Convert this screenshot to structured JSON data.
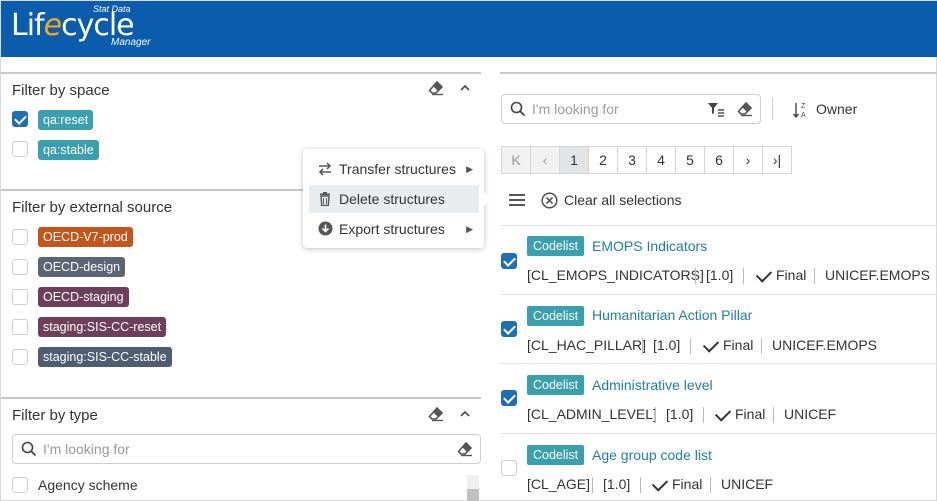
{
  "header": {
    "logo_small_top": "Stat Data",
    "logo_main_pre": "Lif",
    "logo_main_e": "e",
    "logo_main_post": "cycle",
    "logo_small_bottom": "Manager",
    "background_color": "#0b5cad"
  },
  "filter_space": {
    "title": "Filter by space",
    "items": [
      {
        "label": "qa:reset",
        "checked": true,
        "color": "#3aa0ad"
      },
      {
        "label": "qa:stable",
        "checked": false,
        "color": "#3aa0ad"
      }
    ]
  },
  "filter_external": {
    "title": "Filter by external source",
    "items": [
      {
        "label": "OECD-V7-prod",
        "checked": false,
        "color": "#c4561c"
      },
      {
        "label": "OECD-design",
        "checked": false,
        "color": "#5b6573"
      },
      {
        "label": "OECD-staging",
        "checked": false,
        "color": "#6e3f5a"
      },
      {
        "label": "staging:SIS-CC-reset",
        "checked": false,
        "color": "#6e3f5a"
      },
      {
        "label": "staging:SIS-CC-stable",
        "checked": false,
        "color": "#4f5d73"
      }
    ]
  },
  "filter_type": {
    "title": "Filter by type",
    "search_placeholder": "I'm looking for",
    "items": [
      {
        "label": "Agency scheme",
        "checked": false
      }
    ]
  },
  "context_menu": {
    "items": [
      {
        "label": "Transfer structures",
        "icon": "transfer-icon",
        "has_submenu": true
      },
      {
        "label": "Delete structures",
        "icon": "trash-icon",
        "has_submenu": false,
        "active": true
      },
      {
        "label": "Export structures",
        "icon": "download-circle-icon",
        "has_submenu": true
      }
    ]
  },
  "search": {
    "placeholder": "I'm looking for",
    "sort_label": "Owner"
  },
  "pagination": {
    "first": "K",
    "prev": "‹",
    "pages": [
      "1",
      "2",
      "3",
      "4",
      "5",
      "6"
    ],
    "current": "1",
    "next": "›",
    "last": "›|"
  },
  "selection": {
    "clear_label": "Clear all selections"
  },
  "results": [
    {
      "type": "Codelist",
      "title": "EMOPS Indicators",
      "id": "[CL_EMOPS_INDICATORS]",
      "version": "[1.0]",
      "status": "Final",
      "agency": "UNICEF.EMOPS",
      "checked": true
    },
    {
      "type": "Codelist",
      "title": "Humanitarian Action Pillar",
      "id": "[CL_HAC_PILLAR]",
      "version": "[1.0]",
      "status": "Final",
      "agency": "UNICEF.EMOPS",
      "checked": true
    },
    {
      "type": "Codelist",
      "title": "Administrative level",
      "id": "[CL_ADMIN_LEVEL]",
      "version": "[1.0]",
      "status": "Final",
      "agency": "UNICEF",
      "checked": true
    },
    {
      "type": "Codelist",
      "title": "Age group code list",
      "id": "[CL_AGE]",
      "version": "[1.0]",
      "status": "Final",
      "agency": "UNICEF",
      "checked": false
    }
  ]
}
